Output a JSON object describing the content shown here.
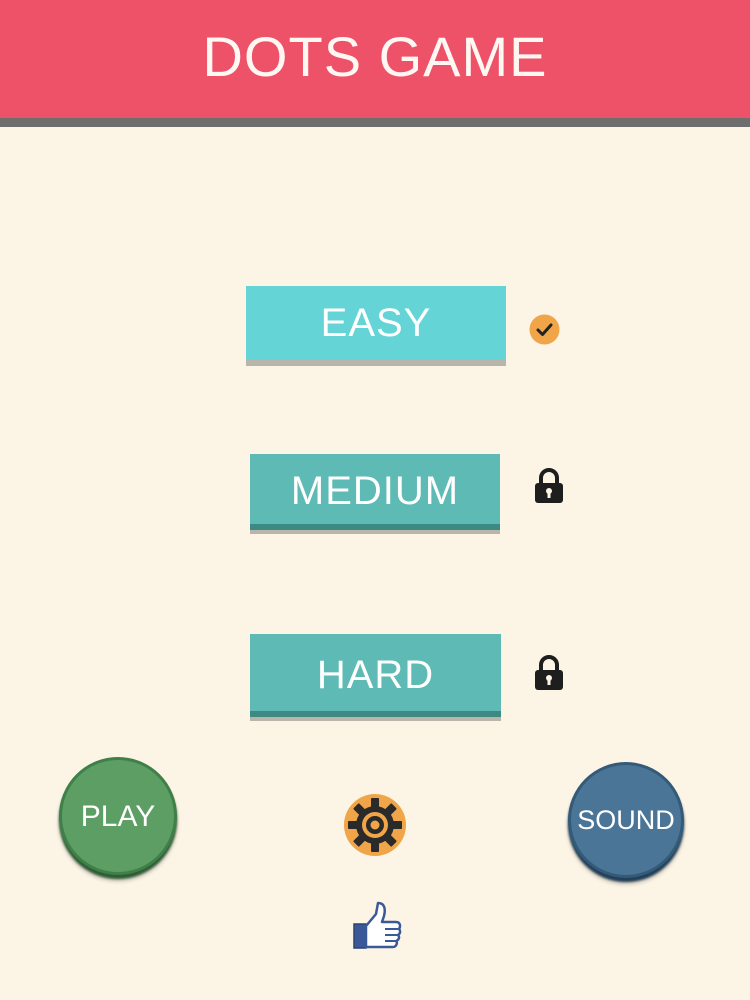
{
  "header": {
    "title": "DOTS GAME",
    "color": "#ee5268"
  },
  "levels": [
    {
      "label": "EASY",
      "status": "unlocked",
      "status_icon": "check-icon"
    },
    {
      "label": "MEDIUM",
      "status": "locked",
      "status_icon": "lock-icon"
    },
    {
      "label": "HARD",
      "status": "locked",
      "status_icon": "lock-icon"
    }
  ],
  "controls": {
    "play_label": "PLAY",
    "sound_label": "SOUND",
    "settings_icon": "gear-icon",
    "like_icon": "thumbs-up-icon"
  },
  "colors": {
    "background": "#fcf5e6",
    "easy_button": "#64d4d6",
    "level_button": "#5ebab4",
    "play_button": "#5c9e64",
    "sound_button": "#4a7596",
    "check_badge": "#f0a548"
  }
}
